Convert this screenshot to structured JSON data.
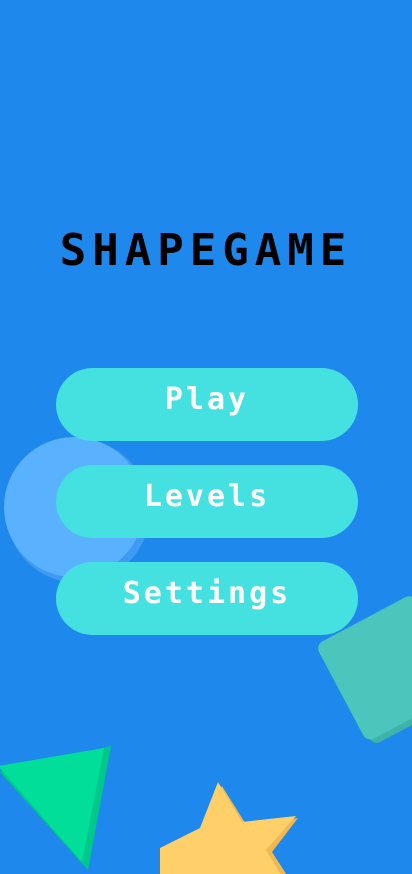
{
  "game": {
    "title": "SHAPEGAME"
  },
  "menu": {
    "play_label": "Play",
    "levels_label": "Levels",
    "settings_label": "Settings"
  },
  "colors": {
    "background": "#1E88EC",
    "button_fill": "#45E0E0",
    "button_text": "#FFFFFF",
    "title_text": "#000000",
    "circle": "#5AB2FF",
    "square": "#4CC6BC",
    "triangle": "#00DE9A",
    "star": "#FFD06A"
  },
  "shapes": [
    "circle",
    "square",
    "triangle",
    "star"
  ]
}
